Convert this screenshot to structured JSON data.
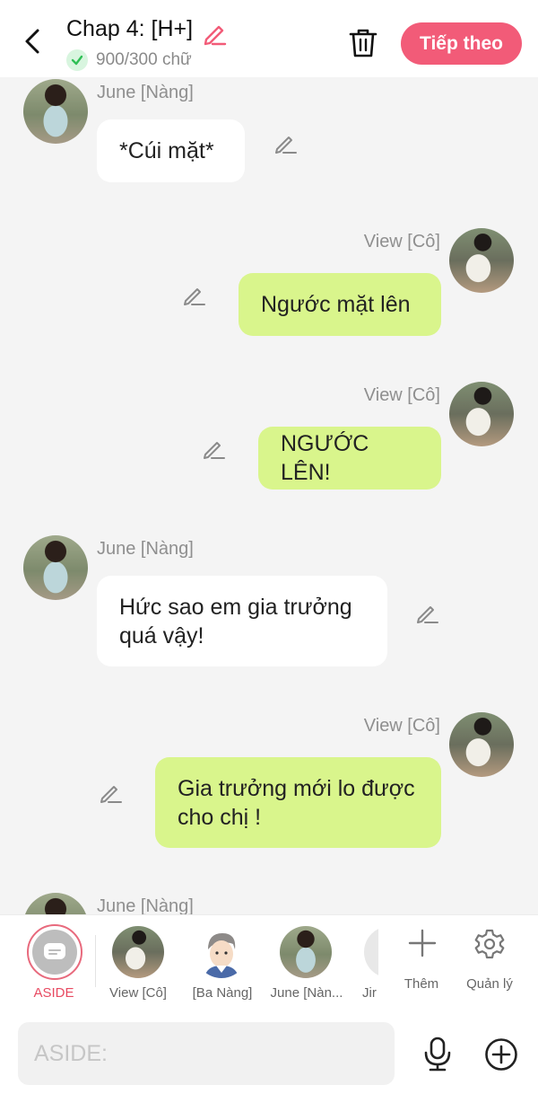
{
  "header": {
    "title": "Chap 4: [H+]",
    "word_count": "900/300 chữ",
    "next_label": "Tiếp theo",
    "accent_color": "#f25b78"
  },
  "messages": [
    {
      "side": "left",
      "sender": "June [Nàng]",
      "text": "*Cúi mặt*"
    },
    {
      "side": "right",
      "sender": "View [Cô]",
      "text": "Ngước mặt lên"
    },
    {
      "side": "right",
      "sender": "View [Cô]",
      "text": "NGƯỚC LÊN!"
    },
    {
      "side": "left",
      "sender": "June [Nàng]",
      "text": "Hức sao em gia trưởng quá vậy!"
    },
    {
      "side": "right",
      "sender": "View [Cô]",
      "text": "Gia trưởng mới lo được cho chị !"
    },
    {
      "side": "left",
      "sender": "June [Nàng]",
      "text": ""
    }
  ],
  "characters": [
    {
      "label": "ASIDE",
      "active": true
    },
    {
      "label": "View [Cô]"
    },
    {
      "label": "[Ba Nàng]"
    },
    {
      "label": "June [Nàn..."
    },
    {
      "label": "Jir"
    }
  ],
  "actions": {
    "add_label": "Thêm",
    "manage_label": "Quản lý"
  },
  "input": {
    "placeholder": "ASIDE:"
  },
  "icons": [
    "back-arrow-icon",
    "pencil-icon",
    "check-icon",
    "trash-icon",
    "message-icon",
    "plus-icon",
    "gear-icon",
    "microphone-icon",
    "add-circle-icon"
  ]
}
